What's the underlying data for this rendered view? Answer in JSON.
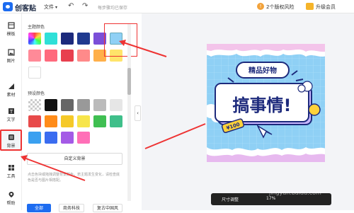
{
  "header": {
    "brand": "创客贴",
    "file_menu": "文件",
    "saved_status": "每步骤均已保存",
    "risk_label": "2个版权风险",
    "vip_label": "升级会员"
  },
  "sidebar": {
    "items": [
      {
        "label": "模板",
        "icon": "template-icon"
      },
      {
        "label": "图片",
        "icon": "image-icon"
      },
      {
        "label": "素材",
        "icon": "material-icon"
      },
      {
        "label": "文字",
        "icon": "text-icon"
      },
      {
        "label": "背景",
        "icon": "background-icon"
      },
      {
        "label": "工具",
        "icon": "tools-icon"
      },
      {
        "label": "帮助",
        "icon": "help-icon"
      }
    ]
  },
  "panel": {
    "theme_title": "主题颜色",
    "preset_title": "预设颜色",
    "theme_colors": [
      "#ff4fa3",
      "#2fe0d8",
      "#1d2a7c",
      "#203a8f",
      "#7b4fd8",
      "#8fd0f5",
      "#ff8a98",
      "#ff6a7d",
      "#e8404f",
      "#ff8a8a",
      "#ffb04a",
      "#ffe46a",
      "#ffffff"
    ],
    "preset_colors": [
      "#cccccc",
      "#111111",
      "#666666",
      "#999999",
      "#bbbbbb",
      "#e6e6e6",
      "#e84a4a",
      "#ff8c1a",
      "#f5c928",
      "#f7e54a",
      "#3fbf52",
      "#3fbf8a",
      "#3aa0f0",
      "#3a6cf0",
      "#a45ae6",
      "#ff6fb7"
    ],
    "custom_bg_button": "自定义背景",
    "note": "点击色块或拖拽调整背景颜色，若主题发生变化，请检查底色是否与图片相搭配。",
    "tabs": [
      "全部",
      "商务科技",
      "复古中国风"
    ]
  },
  "poster": {
    "badge_text": "精品好物",
    "main_text": "搞事情!",
    "tag_text": "¥100"
  },
  "zoom": {
    "label": "尺寸调整",
    "value": "17%"
  },
  "watermark": "jingyan.baidu.com"
}
